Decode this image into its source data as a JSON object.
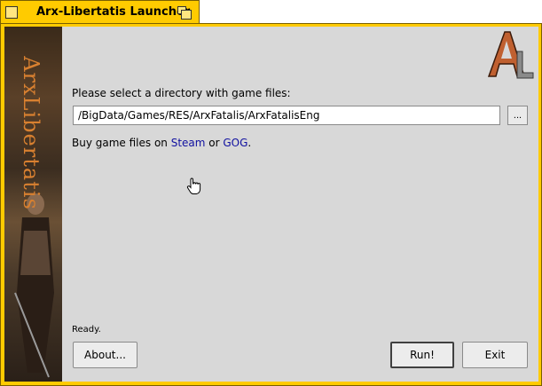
{
  "window": {
    "title": "Arx-Libertatis Launcher"
  },
  "sidebar": {
    "art_text": "ArxLibertatis"
  },
  "main": {
    "prompt": "Please select a directory with game files:",
    "path_value": "/BigData/Games/RES/ArxFatalis/ArxFatalisEng",
    "browse_label": "...",
    "buy_prefix": "Buy game files on ",
    "steam_label": "Steam",
    "buy_or": " or ",
    "gog_label": "GOG",
    "buy_suffix": ".",
    "status": "Ready."
  },
  "buttons": {
    "about": "About...",
    "run": "Run!",
    "exit": "Exit"
  },
  "colors": {
    "titlebar": "#ffcb00",
    "panel": "#d8d8d8",
    "link": "#1010a0",
    "logo_accent": "#c06030"
  },
  "icons": {
    "logo": "arx-libertatis-logo-icon",
    "cursor": "hand-pointer-icon"
  }
}
